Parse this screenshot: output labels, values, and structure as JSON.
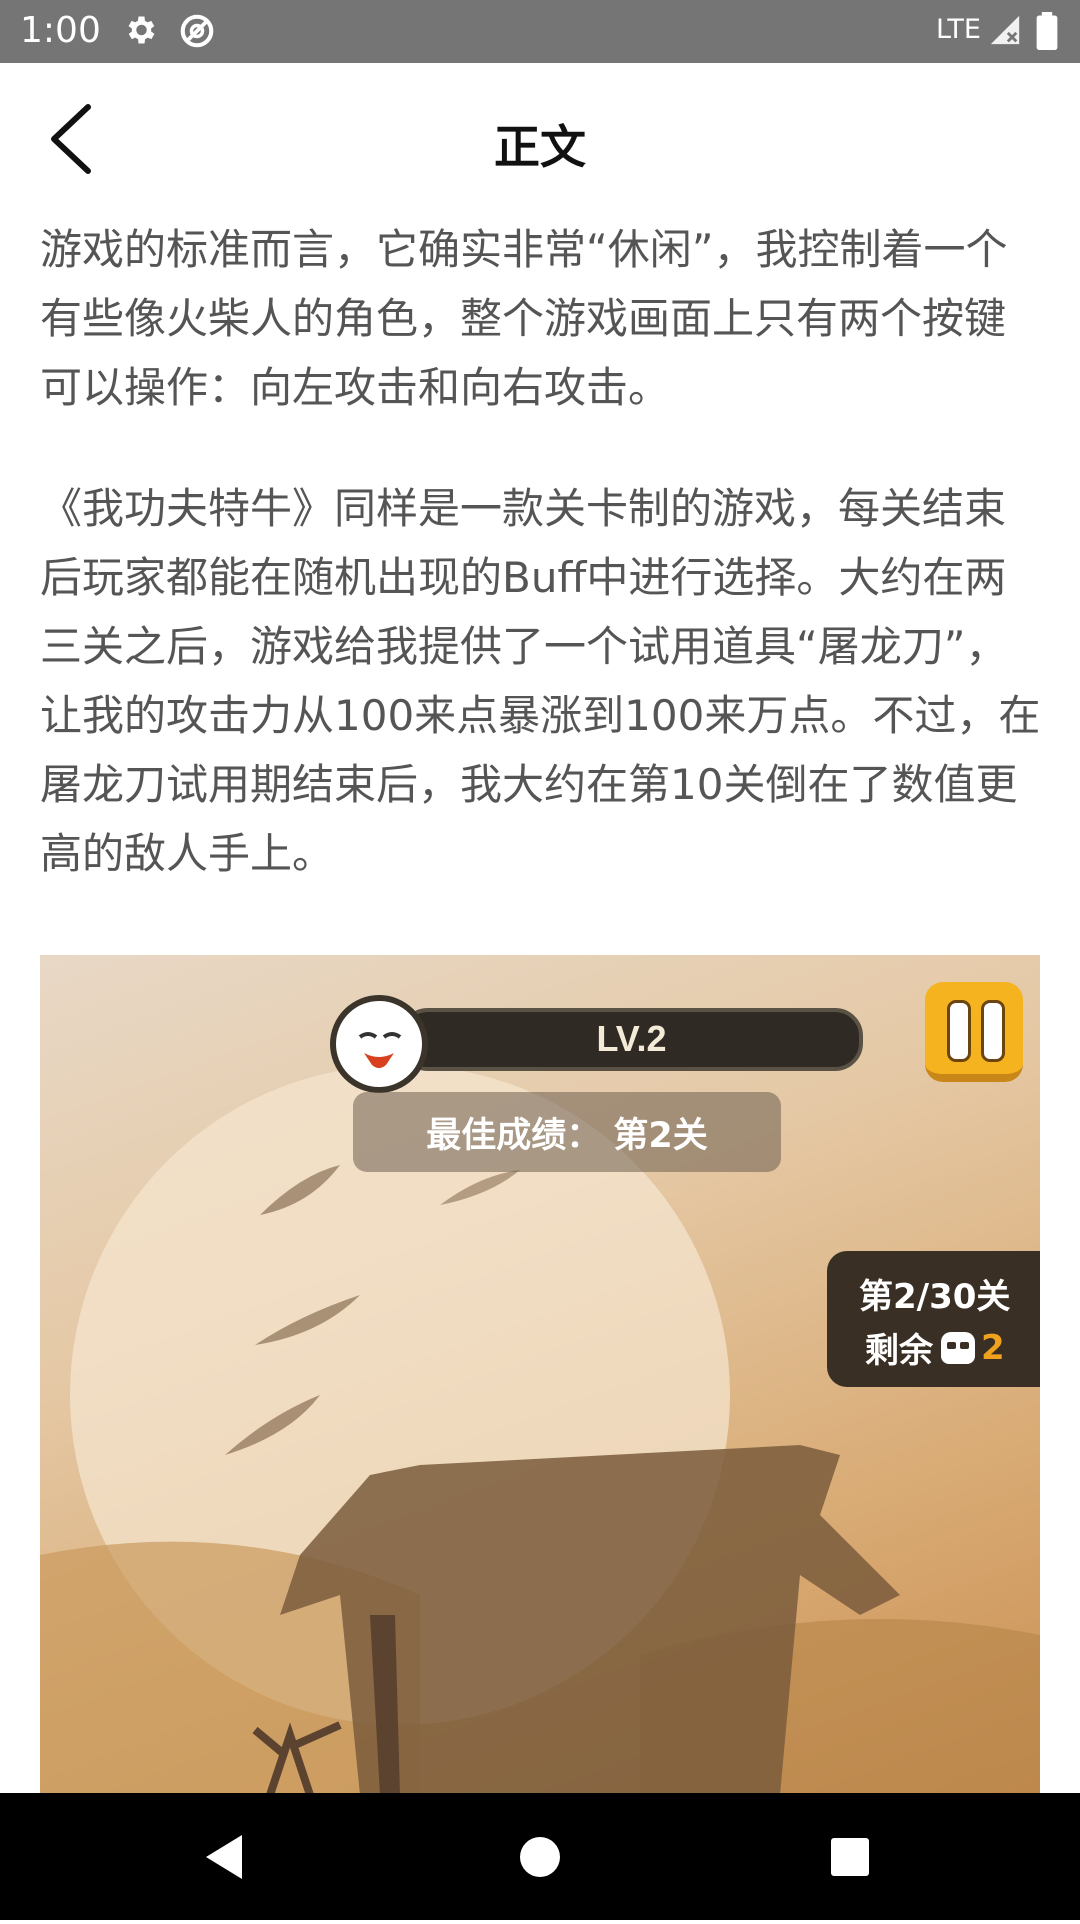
{
  "status_bar": {
    "time": "1:00",
    "network": "LTE",
    "icons": [
      "settings-icon",
      "data-saver-icon",
      "signal-icon",
      "battery-icon"
    ]
  },
  "app_bar": {
    "title": "正文",
    "back_icon": "back-chevron-icon"
  },
  "article": {
    "paragraphs": [
      "游戏的标准而言，它确实非常“休闲”，我控制着一个有些像火柴人的角色，整个游戏画面上只有两个按键可以操作：向左攻击和向右攻击。",
      "《我功夫特牛》同样是一款关卡制的游戏，每关结束后玩家都能在随机出现的Buff中进行选择。大约在两三关之后，游戏给我提供了一个试用道具“屠龙刀”，让我的攻击力从100来点暴涨到100来万点。不过，在屠龙刀试用期结束后，我大约在第10关倒在了数值更高的敌人手上。"
    ]
  },
  "game_screenshot": {
    "level": "LV.2",
    "best_score": "最佳成绩： 第2关",
    "stage": "第2/30关",
    "remaining_label": "剩余",
    "remaining_count": "2",
    "colors": {
      "sky": "#e5c9a6",
      "pause_button": "#f5b320",
      "accent": "#f0a21d"
    }
  },
  "nav_bar": {
    "icons": [
      "nav-back-icon",
      "nav-home-icon",
      "nav-recents-icon"
    ]
  }
}
